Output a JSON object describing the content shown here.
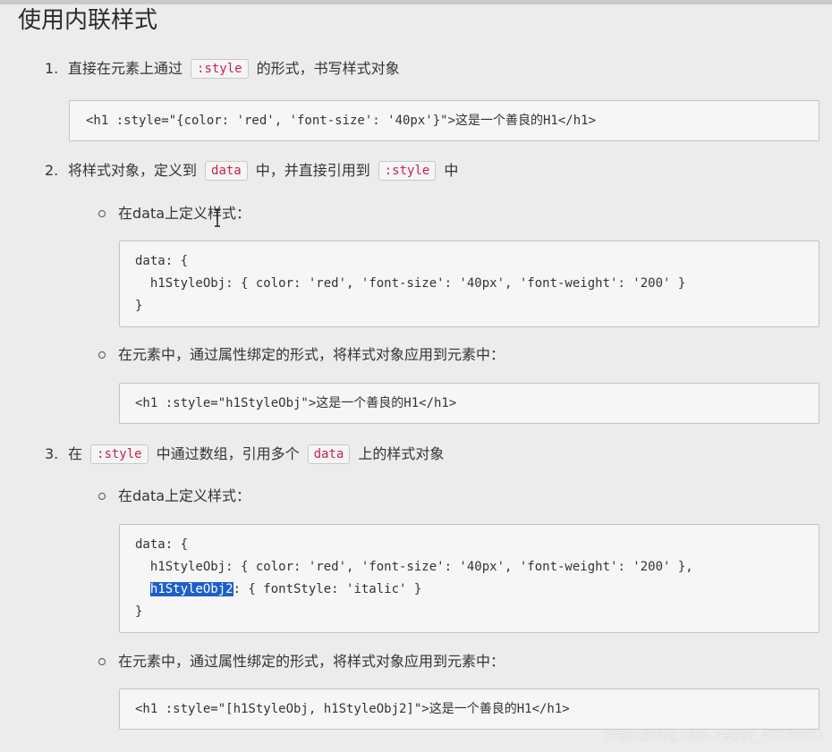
{
  "title": "使用内联样式",
  "items": [
    {
      "number": "1.",
      "text_before": "直接在元素上通过",
      "code1": ":style",
      "text_after": "的形式，书写样式对象",
      "code_block": "<h1 :style=\"{color: 'red', 'font-size': '40px'}\">这是一个善良的H1</h1>"
    },
    {
      "number": "2.",
      "text_before": "将样式对象，定义到",
      "code1": "data",
      "text_mid": "中，并直接引用到",
      "code2": ":style",
      "text_after": "中",
      "sub": [
        {
          "text": "在data上定义样式：",
          "code_lines": [
            "data: {",
            "  h1StyleObj: { color: 'red', 'font-size': '40px', 'font-weight': '200' }",
            "}"
          ]
        },
        {
          "text": "在元素中，通过属性绑定的形式，将样式对象应用到元素中：",
          "code_lines": [
            "<h1 :style=\"h1StyleObj\">这是一个善良的H1</h1>"
          ]
        }
      ]
    },
    {
      "number": "3.",
      "text_before": "在",
      "code1": ":style",
      "text_mid": "中通过数组，引用多个",
      "code2": "data",
      "text_after": "上的样式对象",
      "sub": [
        {
          "text": "在data上定义样式：",
          "code_lines": [
            "data: {",
            "  h1StyleObj: { color: 'red', 'font-size': '40px', 'font-weight': '200' },",
            "  ",
            "}"
          ],
          "highlight": "h1StyleObj2",
          "highlight_rest": ": { fontStyle: 'italic' }"
        },
        {
          "text": "在元素中，通过属性绑定的形式，将样式对象应用到元素中：",
          "code_lines": [
            "<h1 :style=\"[h1StyleObj, h1StyleObj2]\">这是一个善良的H1</h1>"
          ]
        }
      ]
    }
  ],
  "watermark": "https://blog.csdn.net/qq_42238851"
}
